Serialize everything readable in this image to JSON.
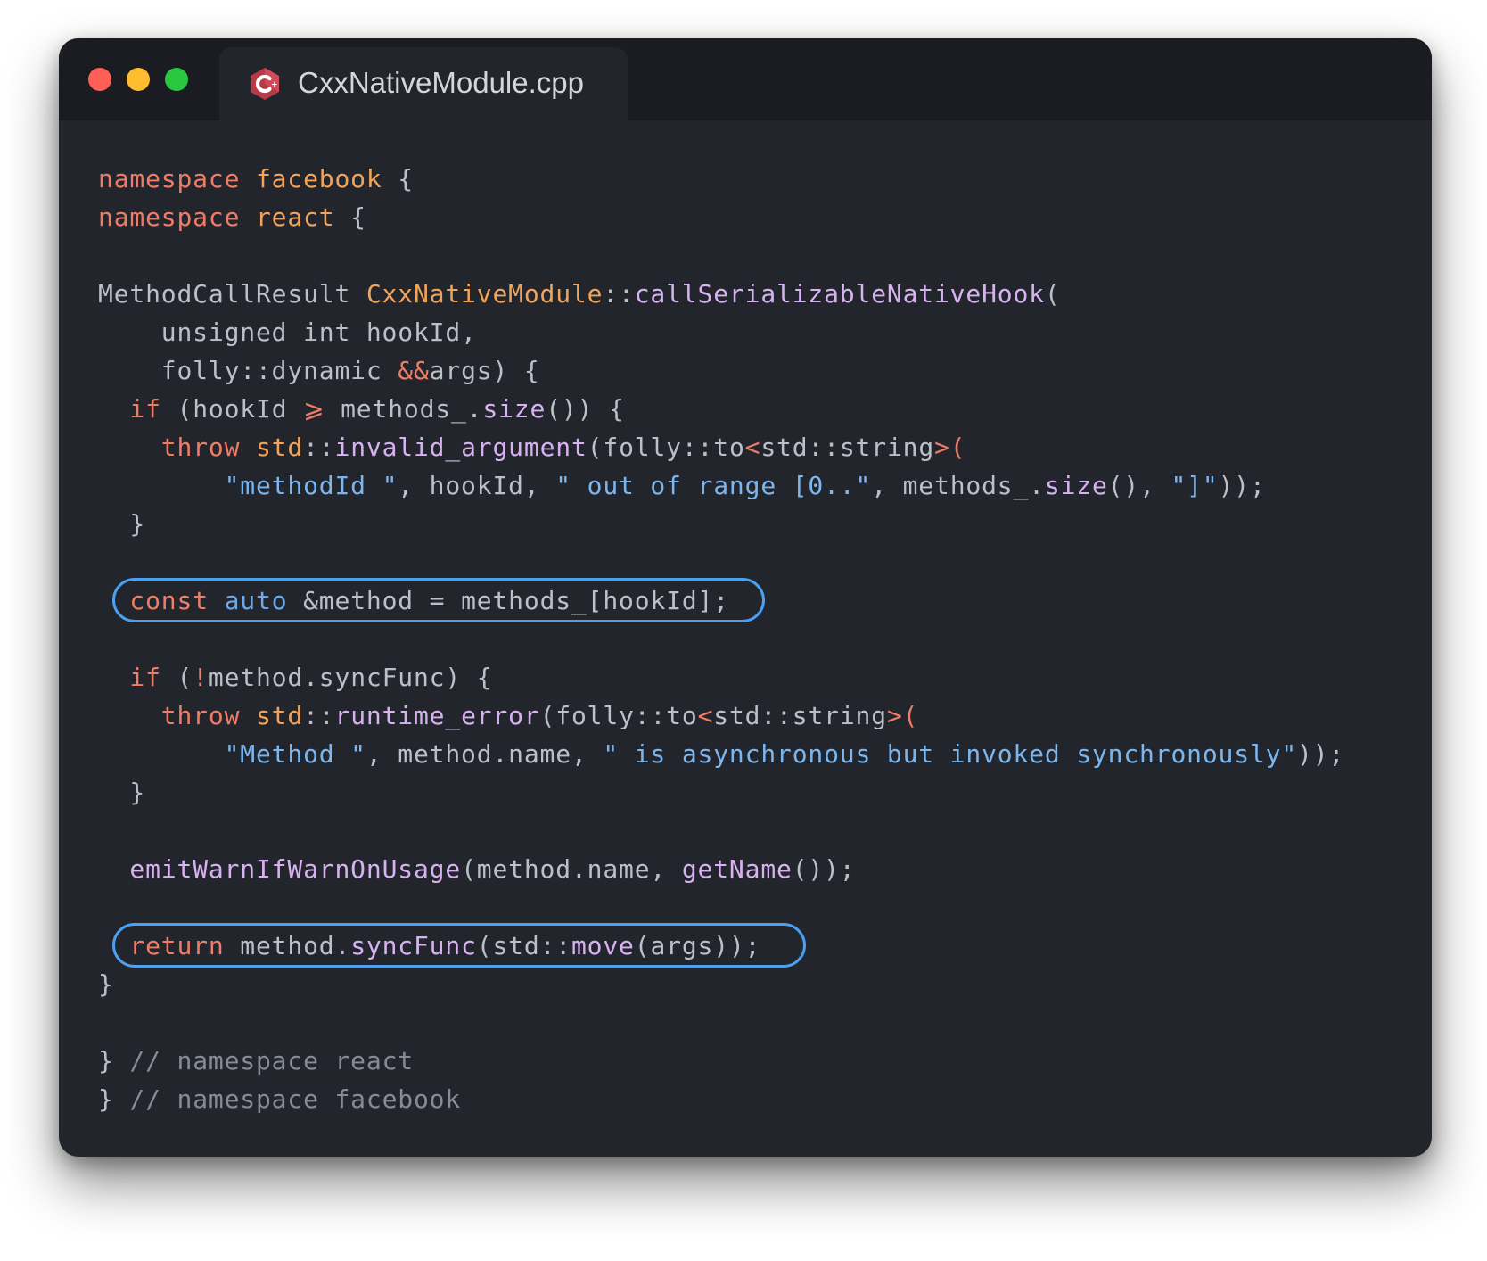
{
  "window": {
    "tab_title": "CxxNativeModule.cpp",
    "tab_icon": "cpp-file-icon",
    "traffic_lights": [
      "#ff5f57",
      "#febc2e",
      "#28c840"
    ]
  },
  "colors": {
    "keyword": "#ee7c66",
    "type": "#f0a35a",
    "function": "#d6b2f0",
    "string": "#7cb6ee",
    "comment": "#868b95",
    "plain": "#bcbfc7",
    "highlight": "#4aa0f2",
    "background": "#23252c"
  },
  "code": {
    "lines": [
      [
        {
          "t": "namespace ",
          "c": "kw"
        },
        {
          "t": "facebook",
          "c": "ty"
        },
        {
          "t": " {"
        }
      ],
      [
        {
          "t": "namespace ",
          "c": "kw"
        },
        {
          "t": "react",
          "c": "ty"
        },
        {
          "t": " {"
        }
      ],
      [],
      [
        {
          "t": "MethodCallResult "
        },
        {
          "t": "CxxNativeModule",
          "c": "ty"
        },
        {
          "t": "::"
        },
        {
          "t": "callSerializableNativeHook",
          "c": "fn"
        },
        {
          "t": "("
        }
      ],
      [
        {
          "t": "    unsigned int hookId,"
        }
      ],
      [
        {
          "t": "    folly::dynamic "
        },
        {
          "t": "&&",
          "c": "kw"
        },
        {
          "t": "args) {"
        }
      ],
      [
        {
          "t": "  "
        },
        {
          "t": "if",
          "c": "kw"
        },
        {
          "t": " (hookId "
        },
        {
          "t": "⩾",
          "c": "kw"
        },
        {
          "t": " methods_."
        },
        {
          "t": "size",
          "c": "fn"
        },
        {
          "t": "()) {"
        }
      ],
      [
        {
          "t": "    "
        },
        {
          "t": "throw",
          "c": "kw"
        },
        {
          "t": " "
        },
        {
          "t": "std",
          "c": "ty"
        },
        {
          "t": "::"
        },
        {
          "t": "invalid_argument",
          "c": "fn"
        },
        {
          "t": "(folly::to"
        },
        {
          "t": "<",
          "c": "kw"
        },
        {
          "t": "std::string"
        },
        {
          "t": ">(",
          "c": "kw"
        }
      ],
      [
        {
          "t": "        "
        },
        {
          "t": "\"methodId \"",
          "c": "st"
        },
        {
          "t": ", hookId, "
        },
        {
          "t": "\" out of range [0..\"",
          "c": "st"
        },
        {
          "t": ", methods_."
        },
        {
          "t": "size",
          "c": "fn"
        },
        {
          "t": "(), "
        },
        {
          "t": "\"]\"",
          "c": "st"
        },
        {
          "t": "));"
        }
      ],
      [
        {
          "t": "  }"
        }
      ],
      [],
      [
        {
          "t": "  "
        },
        {
          "t": "const",
          "c": "kw"
        },
        {
          "t": " "
        },
        {
          "t": "auto",
          "c": "bl"
        },
        {
          "t": " &method = methods_[hookId];"
        }
      ],
      [],
      [
        {
          "t": "  "
        },
        {
          "t": "if",
          "c": "kw"
        },
        {
          "t": " ("
        },
        {
          "t": "!",
          "c": "kw"
        },
        {
          "t": "method.syncFunc) {"
        }
      ],
      [
        {
          "t": "    "
        },
        {
          "t": "throw",
          "c": "kw"
        },
        {
          "t": " "
        },
        {
          "t": "std",
          "c": "ty"
        },
        {
          "t": "::"
        },
        {
          "t": "runtime_error",
          "c": "fn"
        },
        {
          "t": "(folly::to"
        },
        {
          "t": "<",
          "c": "kw"
        },
        {
          "t": "std::string"
        },
        {
          "t": ">(",
          "c": "kw"
        }
      ],
      [
        {
          "t": "        "
        },
        {
          "t": "\"Method \"",
          "c": "st"
        },
        {
          "t": ", method.name, "
        },
        {
          "t": "\" is asynchronous but invoked synchronously\"",
          "c": "st"
        },
        {
          "t": "));"
        }
      ],
      [
        {
          "t": "  }"
        }
      ],
      [],
      [
        {
          "t": "  "
        },
        {
          "t": "emitWarnIfWarnOnUsage",
          "c": "fn"
        },
        {
          "t": "(method.name, "
        },
        {
          "t": "getName",
          "c": "fn"
        },
        {
          "t": "());"
        }
      ],
      [],
      [
        {
          "t": "  "
        },
        {
          "t": "return",
          "c": "kw"
        },
        {
          "t": " method."
        },
        {
          "t": "syncFunc",
          "c": "fn"
        },
        {
          "t": "(std::"
        },
        {
          "t": "move",
          "c": "fn"
        },
        {
          "t": "(args));"
        }
      ],
      [
        {
          "t": "}"
        }
      ],
      [],
      [
        {
          "t": "} "
        },
        {
          "t": "// namespace react",
          "c": "cm"
        }
      ],
      [
        {
          "t": "} "
        },
        {
          "t": "// namespace facebook",
          "c": "cm"
        }
      ]
    ]
  }
}
